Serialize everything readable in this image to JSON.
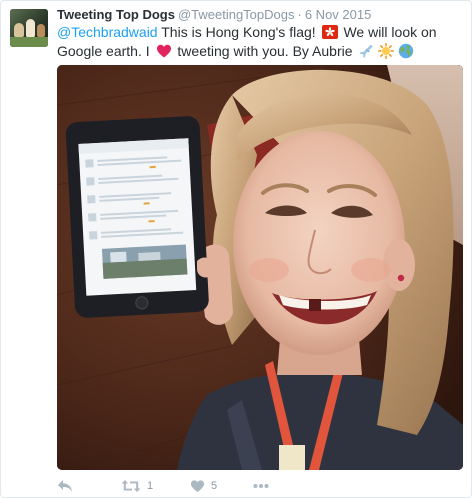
{
  "tweet": {
    "display_name": "Tweeting Top Dogs",
    "handle": "@TweetingTopDogs",
    "separator": "·",
    "date": "6 Nov 2015",
    "text": {
      "mention": "@Techbradwaid",
      "part1": " This is Hong Kong's flag! ",
      "part2": " We will look on Google earth. I ",
      "part3": " tweeting with you. By Aubrie "
    },
    "emojis": [
      "hong-kong-flag-icon",
      "heart-icon",
      "airplane-icon",
      "sun-icon",
      "globe-icon"
    ],
    "photo": {
      "subject": "photo-girl-holding-ipad"
    },
    "actions": {
      "retweet_count": "1",
      "like_count": "5"
    }
  },
  "colors": {
    "link": "#1da1f2",
    "text": "#292f33",
    "muted": "#8899a6",
    "icon": "#aab8c2",
    "hk_flag": "#de2910",
    "heart": "#e0245e"
  }
}
